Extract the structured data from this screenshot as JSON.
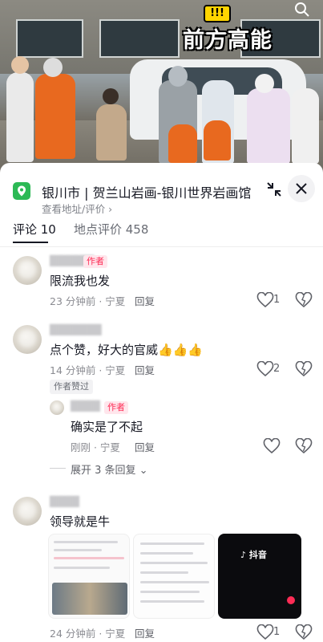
{
  "video": {
    "headline": "前方高能",
    "sticker": "!!!"
  },
  "location": {
    "title": "银川市 | 贺兰山岩画-银川世界岩画馆",
    "subtitle": "查看地址/评价 ›"
  },
  "tabs": [
    {
      "label": "评论 10"
    },
    {
      "label": "地点评价 458"
    }
  ],
  "comments": [
    {
      "badge": "作者",
      "text": "限流我也发",
      "time_loc": "23 分钟前 · 宁夏",
      "reply": "回复",
      "likes": "1"
    },
    {
      "text": "点个赞，好大的官威👍👍👍",
      "time_loc": "14 分钟前 · 宁夏",
      "reply": "回复",
      "likes": "2",
      "liked_tag": "作者赞过",
      "sub": {
        "badge": "作者",
        "text": "确实是了不起",
        "time_loc": "刚刚 · 宁夏",
        "reply": "回复"
      },
      "expand": "展开 3 条回复 ⌄"
    },
    {
      "text": "领导就是牛",
      "time_loc": "24 分钟前 · 宁夏",
      "reply": "回复",
      "likes": "1",
      "thumb3_logo": "♪ 抖音"
    }
  ],
  "colors": {
    "accent": "#fe2c55",
    "pin": "#2cb955"
  }
}
